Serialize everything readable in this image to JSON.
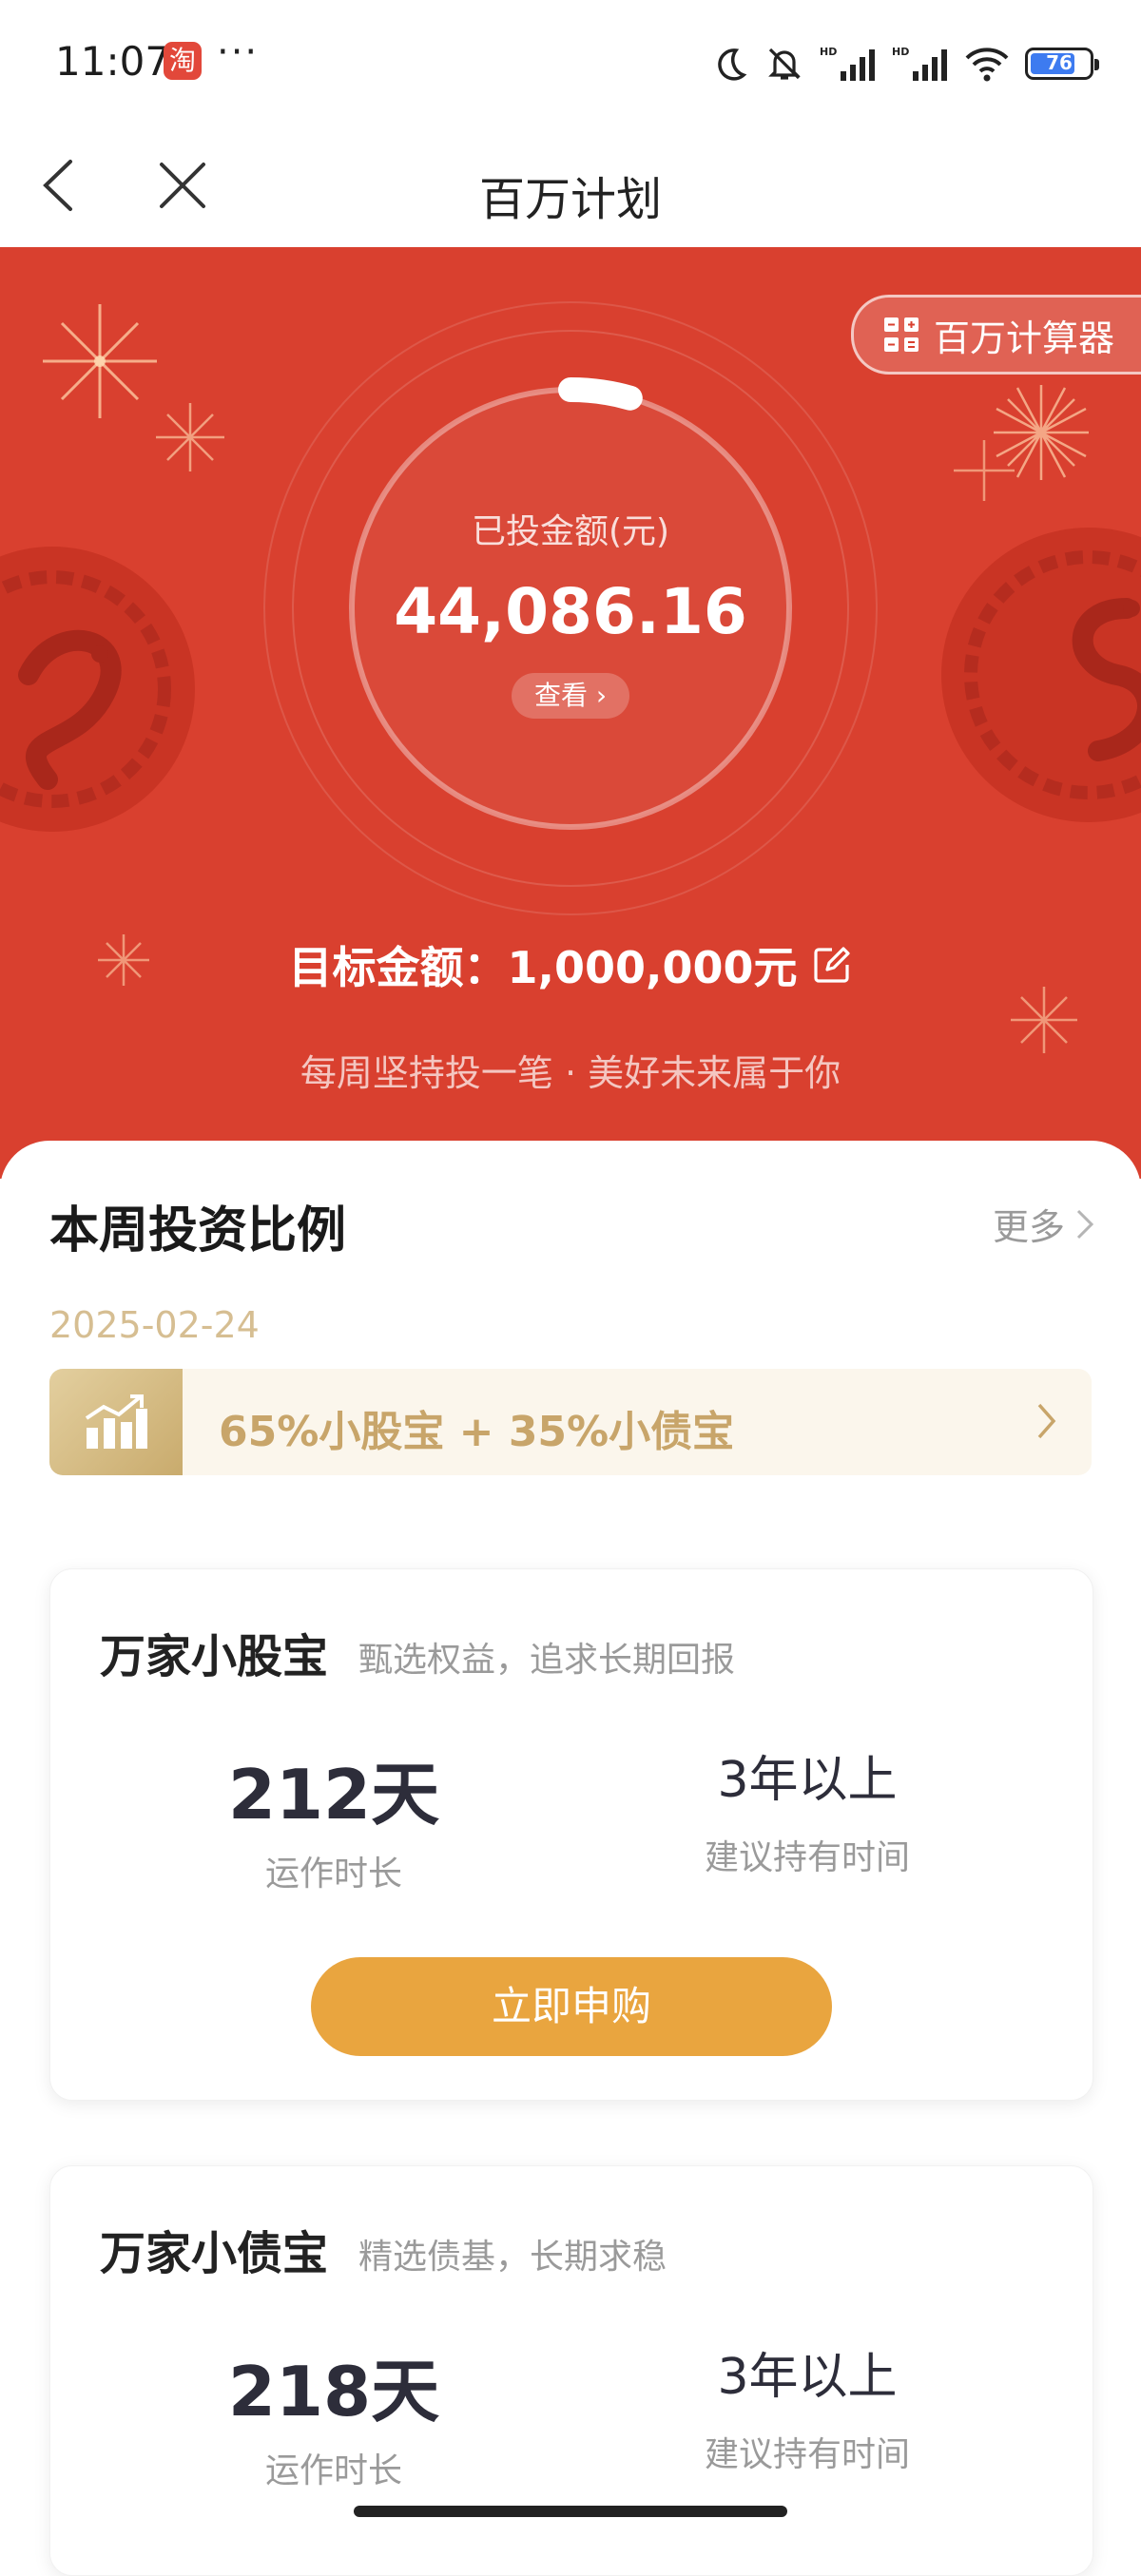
{
  "status_bar": {
    "time": "11:07",
    "app_badge": "淘",
    "more": "···",
    "battery": "76"
  },
  "nav": {
    "title": "百万计划"
  },
  "hero": {
    "calculator_label": "百万计算器",
    "invested_label": "已投金额(元)",
    "invested_amount": "44,086.16",
    "view_label": "查看 ›",
    "target_label": "目标金额：1,000,000元",
    "slogan": "每周坚持投一笔 · 美好未来属于你",
    "progress_fraction": 0.044
  },
  "weekly": {
    "title": "本周投资比例",
    "more": "更多",
    "date": "2025-02-24",
    "ratio": "65%小股宝 + 35%小债宝"
  },
  "funds": [
    {
      "name": "万家小股宝",
      "desc": "甄选权益，追求长期回报",
      "days": "212天",
      "days_label": "运作时长",
      "hold": "3年以上",
      "hold_label": "建议持有时间",
      "button": "立即申购"
    },
    {
      "name": "万家小债宝",
      "desc": "精选债基，长期求稳",
      "days": "218天",
      "days_label": "运作时长",
      "hold": "3年以上",
      "hold_label": "建议持有时间"
    }
  ],
  "colors": {
    "hero_red": "#d9402f",
    "accent_gold": "#e9a53f",
    "ratio_gold": "#c8a56a"
  }
}
